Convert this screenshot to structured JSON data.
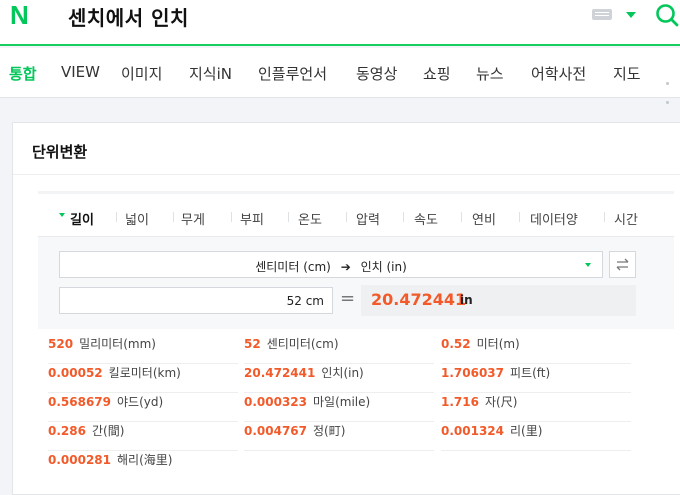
{
  "header": {
    "logo": "N",
    "query": "센치에서 인치",
    "icons": [
      "keyboard-icon",
      "caret-down-icon",
      "search-icon"
    ],
    "accent": "#03c75a"
  },
  "tabs": [
    {
      "label": "통합",
      "active": true
    },
    {
      "label": "VIEW"
    },
    {
      "label": "이미지"
    },
    {
      "label": "지식iN"
    },
    {
      "label": "인플루언서"
    },
    {
      "label": "동영상"
    },
    {
      "label": "쇼핑"
    },
    {
      "label": "뉴스"
    },
    {
      "label": "어학사전"
    },
    {
      "label": "지도"
    }
  ],
  "card": {
    "title": "단위변환",
    "categories": [
      {
        "label": "길이",
        "active": true
      },
      {
        "label": "넓이"
      },
      {
        "label": "무게"
      },
      {
        "label": "부피"
      },
      {
        "label": "온도"
      },
      {
        "label": "압력"
      },
      {
        "label": "속도"
      },
      {
        "label": "연비"
      },
      {
        "label": "데이터양"
      },
      {
        "label": "시간"
      }
    ],
    "conversion": {
      "from_unit": "센티미터 (cm)",
      "arrow": "➔",
      "to_unit": "인치 (in)",
      "input_value": "52 cm",
      "equals": "=",
      "result_value": "20.472441",
      "result_unit": "in"
    },
    "results": [
      [
        {
          "value": "520",
          "unit": "밀리미터(mm)"
        },
        {
          "value": "52",
          "unit": "센티미터(cm)"
        },
        {
          "value": "0.52",
          "unit": "미터(m)"
        }
      ],
      [
        {
          "value": "0.00052",
          "unit": "킬로미터(km)"
        },
        {
          "value": "20.472441",
          "unit": "인치(in)"
        },
        {
          "value": "1.706037",
          "unit": "피트(ft)"
        }
      ],
      [
        {
          "value": "0.568679",
          "unit": "야드(yd)"
        },
        {
          "value": "0.000323",
          "unit": "마일(mile)"
        },
        {
          "value": "1.716",
          "unit": "자(尺)"
        }
      ],
      [
        {
          "value": "0.286",
          "unit": "간(間)"
        },
        {
          "value": "0.004767",
          "unit": "정(町)"
        },
        {
          "value": "0.001324",
          "unit": "리(里)"
        }
      ],
      [
        {
          "value": "0.000281",
          "unit": "해리(海里)"
        }
      ]
    ]
  }
}
